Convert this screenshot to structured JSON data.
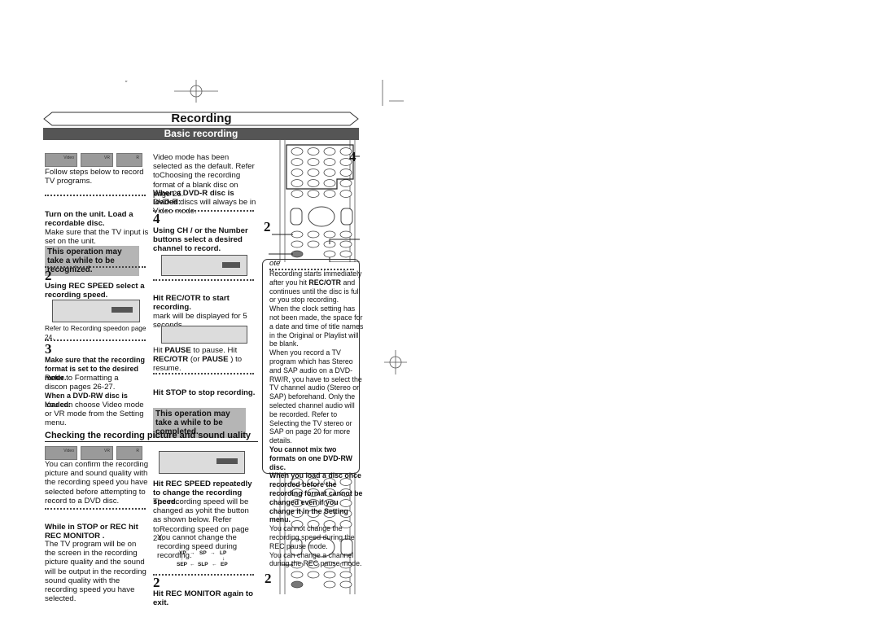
{
  "header": {
    "title": "Recording",
    "section": "Basic recording"
  },
  "discs": [
    "Video",
    "VR",
    "R"
  ],
  "col1": {
    "intro": "Follow steps below to record TV programs.",
    "step1_title": "Turn on the unit. Load a recordable disc.",
    "step1_text": "Make sure that the TV input is set on the unit.",
    "step1_note": "This operation may take a while to be recognized.",
    "step2_num": "2",
    "step2_title": "Using REC SPEED  select a recording speed.",
    "step2_ref": "Refer to  Recording speedon page 24.",
    "step3_num": "3",
    "step3_title": "Make sure that the recording format is set to the desired mode.",
    "step3_ref": "Refer to  Formatting a discon pages 26-27.",
    "step3_rw_title": "When a DVD-RW disc is loaded:",
    "step3_rw_text": "You can choose Video mode or VR mode from the Setting menu."
  },
  "col2": {
    "video_default": " Video mode has been selected as the default. Refer toChoosing the recording format of a blank disc  on page 26.",
    "dvdr_title": "When a DVD-R disc is loaded:",
    "dvdr_text": "DVD-R discs will always be in Video mode.",
    "step4_num": "4",
    "step4_title": "Using  CH    /     or the Number buttons  select a desired channel to record.",
    "step5_title": "Hit  REC/OTR   to start recording.",
    "step5_text": "     mark will be displayed for 5 seconds.",
    "pause_text_1": "Hit ",
    "pause_b1": "PAUSE",
    "pause_text_2": "      to pause. Hit ",
    "pause_b2": "REC/OTR",
    "pause_text_3": "  (or ",
    "pause_b3": "PAUSE",
    "pause_text_4": "     ) to resume.",
    "step6_title": "Hit  STOP       to stop recording.",
    "step6_note": "This operation may take a while to be completed."
  },
  "remote": {
    "callout_top": "4",
    "callout_left": "2",
    "callout_bottom": "2"
  },
  "note": {
    "heading": "ote",
    "p1_a": "Recording starts immediately after you hit ",
    "p1_b": "REC/OTR",
    "p1_c": "   and continues until the disc is full or you stop recording.",
    "p2": "When the clock setting has not been made, the space for a date and time of title names in the Original or Playlist will be blank.",
    "p3": "When you record a TV program which has Stereo and SAP audio on a DVD-RW/R, you have to select the TV channel audio (Stereo or SAP) beforehand. Only the selected channel audio will be recorded. Refer to  Selecting the TV stereo or SAP on page 20 for more details.",
    "p4": "You cannot mix two formats on one DVD-RW disc.",
    "p5": "When you load a disc once recorded before  the recording format cannot be changed even if you change it in the Setting menu.",
    "p6": "You cannot change the recording speed during the REC pause mode.",
    "p7": "You can change a channel during the REC pause mode."
  },
  "check": {
    "title": "Checking the recording picture and sound   uality",
    "intro": "You can confirm the recording picture and sound quality with the recording speed you have selected before attempting to record to a DVD disc.",
    "step1_title": "While in STOP or REC  hit  REC MONITOR .",
    "step1_text": "The TV program will be on the screen in the recording picture quality and the sound will be output in the recording sound quality with the recording speed you have selected.",
    "speed_title": "Hit  REC SPEED   repeatedly to change the recording speed.",
    "speed_text": "The recording speed will be changed as yohit the button as shown below. Refer toRecording speed on page 24.",
    "speed_note": "You cannot change the recording speed during recording.",
    "cycle": [
      "XP",
      "SP",
      "LP",
      "EP",
      "SLP",
      "SEP"
    ],
    "step2_num": "2",
    "step2_title": "Hit  REC MONITOR  again to exit."
  }
}
